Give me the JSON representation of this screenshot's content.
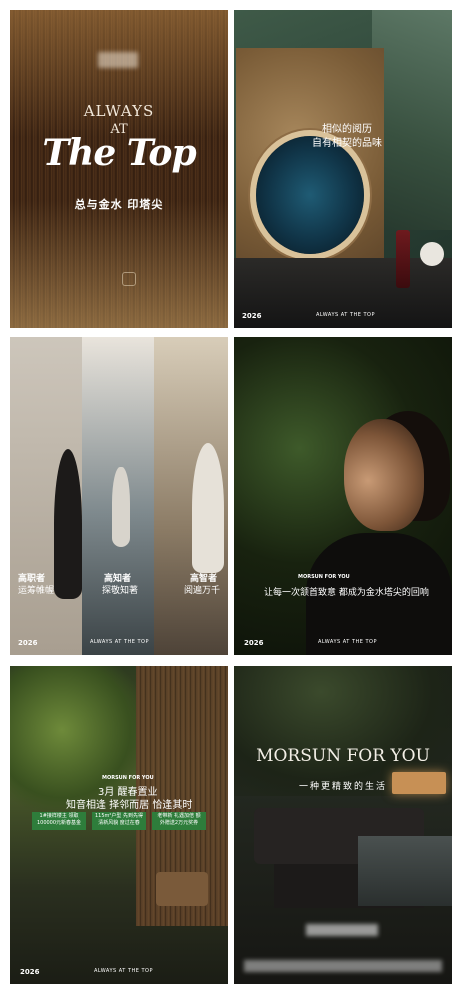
{
  "poster1": {
    "line_always": "ALWAYS",
    "line_at": "AT",
    "line_thetop": "The Top",
    "slogan": "总与金水 印塔尖"
  },
  "poster2": {
    "quote_line1": "相似的阅历",
    "quote_line2": "自有相契的品味",
    "year": "2026",
    "footer": "ALWAYS AT THE TOP"
  },
  "poster3": {
    "items": [
      {
        "title": "高职者",
        "subtitle": "运筹帷幄"
      },
      {
        "title": "高知者",
        "subtitle": "探敬知著"
      },
      {
        "title": "高智者",
        "subtitle": "阅遍万千"
      }
    ],
    "year": "2026",
    "footer": "ALWAYS AT THE TOP"
  },
  "poster4": {
    "brand": "MORSUN FOR YOU",
    "line": "让每一次颔首致意 都成为金水塔尖的回响",
    "year": "2026",
    "footer": "ALWAYS AT THE TOP"
  },
  "poster5": {
    "brand": "MORSUN FOR YOU",
    "line1": "3月 醒春置业",
    "line2": "知音相逢 择邻而居 恰逢其时",
    "badges": [
      {
        "text": "1#接样楼主 领取100000元新春基金"
      },
      {
        "text": "115m²户型 先到先得 清新风貌 度过在春"
      },
      {
        "text": "老带新 礼遇加倍 额外赠送2万元奖券"
      }
    ],
    "year": "2026",
    "footer": "ALWAYS AT THE TOP"
  },
  "poster6": {
    "title": "MORSUN FOR YOU",
    "subtitle": "一种更精致的生活"
  },
  "colors": {
    "badge_green": "#2e7d3b",
    "text_white": "#ffffff"
  }
}
